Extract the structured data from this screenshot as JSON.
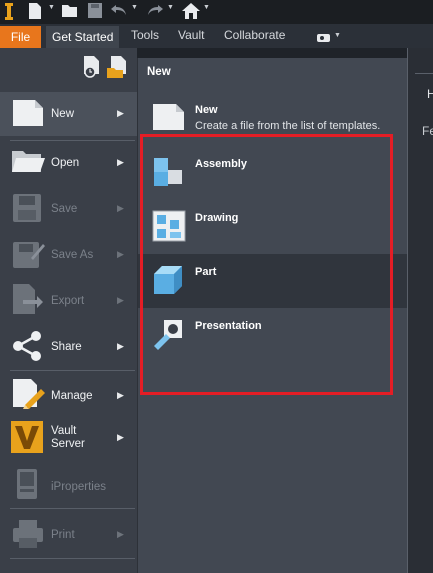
{
  "tabs": {
    "file": "File",
    "get_started": "Get Started",
    "tools": "Tools",
    "vault": "Vault",
    "collaborate": "Collaborate"
  },
  "left_menu": {
    "new": "New",
    "open": "Open",
    "save": "Save",
    "save_as": "Save As",
    "export": "Export",
    "share": "Share",
    "manage": "Manage",
    "vault_server_line1": "Vault",
    "vault_server_line2": "Server",
    "iproperties": "iProperties",
    "print": "Print"
  },
  "flyout": {
    "title": "New",
    "new_title": "New",
    "new_desc": "Create a file from the list of templates.",
    "assembly": "Assembly",
    "drawing": "Drawing",
    "part": "Part",
    "presentation": "Presentation"
  },
  "right_pane": {
    "heading_fragment": "H",
    "label_fragment": "Fe"
  },
  "colors": {
    "file_tab": "#e8761c",
    "highlight_box": "#e41d25",
    "menu_bg": "#3a3f48",
    "flyout_bg": "#424852"
  }
}
